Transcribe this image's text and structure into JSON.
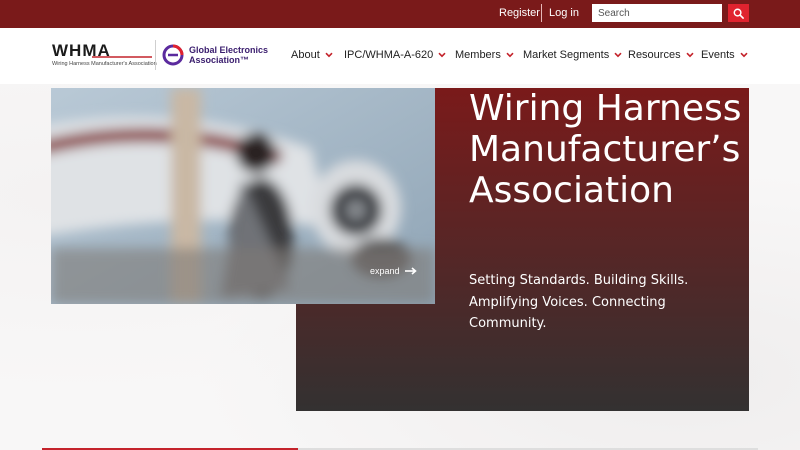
{
  "topbar": {
    "register_label": "Register",
    "login_label": "Log in",
    "search_placeholder": "Search",
    "search_icon": "search-icon",
    "background_color": "#7a1a1a",
    "search_button_color": "#e0232f"
  },
  "brand": {
    "whma_mark": "WHMA",
    "whma_subtitle": "Wiring Harness Manufacturer's Association",
    "gea_line1": "Global Electronics",
    "gea_line2": "Association™",
    "gea_color": "#3a1d6e"
  },
  "nav": {
    "items": [
      {
        "label": "About"
      },
      {
        "label": "IPC/WHMA-A-620"
      },
      {
        "label": "Members"
      },
      {
        "label": "Market Segments"
      },
      {
        "label": "Resources"
      },
      {
        "label": "Events"
      }
    ],
    "chevron_icon": "chevron-down-icon",
    "chevron_color": "#c4232b"
  },
  "hero": {
    "title": "Wiring Harness Manufacturer’s Association",
    "tagline": "Setting Standards. Building Skills. Amplifying Voices. Connecting Community.",
    "expand_label": "expand",
    "expand_icon": "arrow-right-icon",
    "card_gradient_top": "#7a1a1a",
    "card_gradient_bottom": "#333131"
  }
}
